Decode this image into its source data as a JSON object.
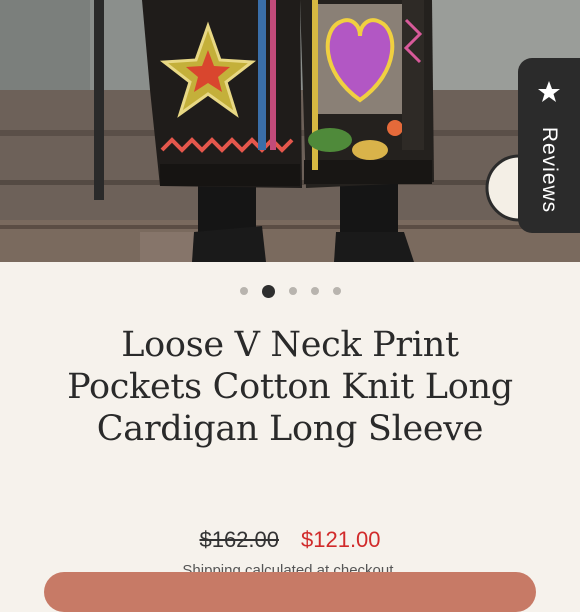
{
  "product": {
    "title": "Loose V Neck Print Pockets Cotton Knit Long Cardigan Long Sleeve",
    "compare_price": "$162.00",
    "sale_price": "$121.00",
    "shipping_note": "Shipping calculated at checkout."
  },
  "gallery": {
    "image_count": 5,
    "active_index": 1
  },
  "reviews_tab": {
    "label": "Reviews",
    "icon": "star-icon"
  },
  "colors": {
    "background": "#f6f2ec",
    "sale_price": "#d12b2b",
    "reviews_tab": "#2b2b2b",
    "cta_button": "#c77a66"
  }
}
